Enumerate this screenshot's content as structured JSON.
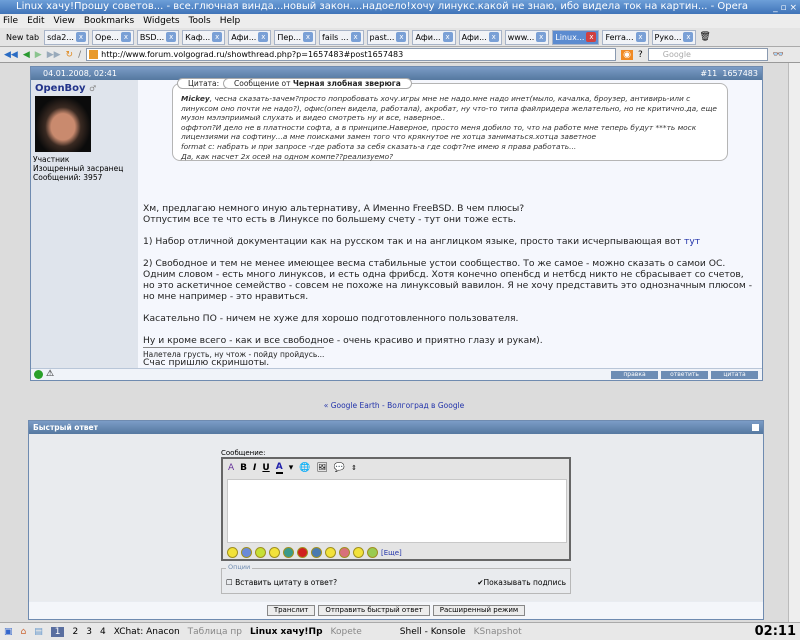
{
  "window": {
    "title": "Linux хачу!Прошу советов... - все.глючная винда...новый закон....надоело!хочу линукс.какой не знаю, ибо видела ток на картин... - Opera",
    "controls": "_ ▫ ×"
  },
  "menu": [
    "File",
    "Edit",
    "View",
    "Bookmarks",
    "Widgets",
    "Tools",
    "Help"
  ],
  "tabs": [
    {
      "label": "New tab"
    },
    {
      "label": "sda2..."
    },
    {
      "label": "Ope..."
    },
    {
      "label": "BSD..."
    },
    {
      "label": "Каф..."
    },
    {
      "label": "Афи..."
    },
    {
      "label": "Пер..."
    },
    {
      "label": "fails ..."
    },
    {
      "label": "past..."
    },
    {
      "label": "Афи..."
    },
    {
      "label": "Афи..."
    },
    {
      "label": "www..."
    },
    {
      "label": "Linux..."
    },
    {
      "label": "Ferra..."
    },
    {
      "label": "Руко..."
    }
  ],
  "address": {
    "url": "http://www.forum.volgograd.ru/showthread.php?p=1657483#post1657483",
    "search_placeholder": "Google"
  },
  "post": {
    "date": "04.01.2008, 02:41",
    "number": "#11",
    "id": "1657483",
    "user": {
      "name": "OpenBoy",
      "rank": "Участник",
      "title": "Изощренный засранец",
      "posts": "Сообщений: 3957"
    },
    "quote": {
      "tab1": "Цитата:",
      "tab2_prefix": "Сообщение от ",
      "author": "Черная злобная зверюга",
      "lead": "Mickey",
      "lines": [
        ", чесна сказать-зачем?просто попробовать хочу.игры мне не надо.мне надо инет(мыло, качалка, броузер, антивирь-или с линуксом оно почти не надо?), офис(опен видела, работала), акробат, ну что-то типа файлридера желательно, но не критично.да, еще музон мэлэприимый слухать и видео смотреть ну и все, наверное..",
        "оффтоп?И дело не в платности софта, а в принципе.Наверное, просто меня добило то, что на работе мне теперь будут ***ть моск лицензиями на софтину...а мне поисками замен того что крякнутое не хотца заниматься.хотца заветное",
        "format c: набрать и при запросе -где работа за себя сказать-а где софт?не имею я права работать...",
        "Да, как насчет 2х осей на одном компе??реализуемо?"
      ]
    },
    "paragraphs": [
      "Хм, предлагаю немного иную альтернативу, А Именно FreeBSD. В чем плюсы?\nОтпустим все те что есть в Линуксе по большему счету - тут они тоже есть.",
      "1) Набор отличной документации как на русском так и на англицком языке, просто таки исчерпывающая вот ",
      "2) Свободное и тем не менее имеющее весма стабильные устои сообщество. То же самое - можно сказать о самои ОС. Одним словом - есть много линуксов, и есть одна фрибсд. Хотя конечно опенбсд и нетбсд никто не сбрасывает со счетов, но это аскетичное семейство - совсем не похоже на линуксовый вавилон. Я не хочу представить это однозначным плюсом - но мне например - это нравиться.",
      "Касательно ПО - ничем не хуже для хорошо подготовленного пользователя.",
      "Ну и кроме всего - как и все свободное - очень красиво и приятно глазу и рукам).",
      "Счас пришлю скриншоты."
    ],
    "link_here": "тут",
    "signature": "Налетела грусть, ну чтож - пойду пройдусь...",
    "buttons": {
      "edit": "правка",
      "reply": "ответить",
      "quote": "цитата"
    }
  },
  "nav_link": {
    "prefix": "« ",
    "text": "Google Earth - Волгоград в Google"
  },
  "quick_reply": {
    "title": "Быстрый ответ",
    "message_label": "Сообщение:",
    "more_smilies": "[Еще]",
    "options_legend": "Опции",
    "insert_quote": "Вставить цитату в ответ?",
    "show_signature": "Показывать подпись",
    "show_signature_checked": true,
    "insert_quote_checked": false,
    "buttons": {
      "translit": "Транслит",
      "send": "Отправить быстрый ответ",
      "advanced": "Расширенный режим"
    }
  },
  "taskbar": {
    "desktops": [
      "1",
      "2",
      "3",
      "4"
    ],
    "tasks": [
      "XChat: Anacon",
      "Таблица пр",
      "Linux хачу!Пр",
      "Kopete",
      "Shell - Konsole",
      "KSnapshot"
    ],
    "clock": "02:11"
  }
}
